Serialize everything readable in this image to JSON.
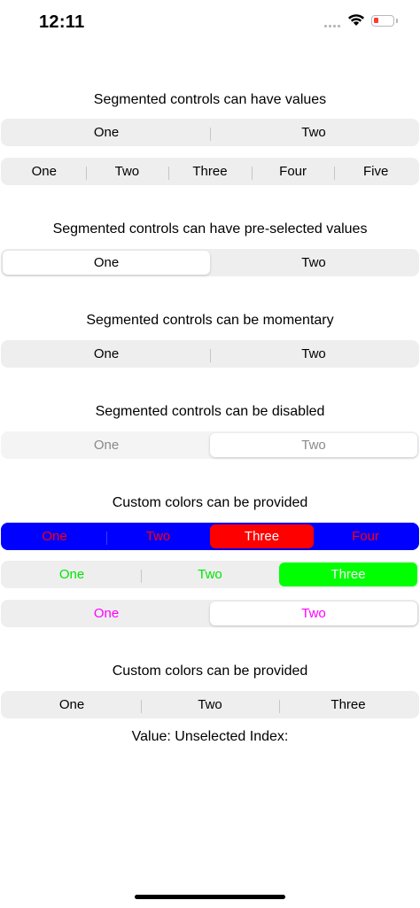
{
  "status": {
    "time": "12:11"
  },
  "sections": {
    "values": {
      "heading": "Segmented controls can have values",
      "two": [
        "One",
        "Two"
      ],
      "five": [
        "One",
        "Two",
        "Three",
        "Four",
        "Five"
      ]
    },
    "preselected": {
      "heading": "Segmented controls can have pre-selected values",
      "segments": [
        "One",
        "Two"
      ],
      "selected": "One"
    },
    "momentary": {
      "heading": "Segmented controls can be momentary",
      "segments": [
        "One",
        "Two"
      ]
    },
    "disabled": {
      "heading": "Segmented controls can be disabled",
      "segments": [
        "One",
        "Two"
      ],
      "selected": "Two"
    },
    "custom_colors": {
      "heading": "Custom colors can be provided",
      "blue": {
        "segments": [
          "One",
          "Two",
          "Three",
          "Four"
        ],
        "selected": "Three",
        "background": "#0000ff",
        "tint": "#ff0000",
        "text": "#ff0000"
      },
      "green": {
        "segments": [
          "One",
          "Two",
          "Three"
        ],
        "selected": "Three",
        "tint": "#00ff00",
        "text": "#00e600"
      },
      "magenta": {
        "segments": [
          "One",
          "Two"
        ],
        "selected": "Two",
        "text": "#ff00ff"
      }
    },
    "custom_colors_2": {
      "heading": "Custom colors can be provided",
      "segments": [
        "One",
        "Two",
        "Three"
      ],
      "value_line": "Value: Unselected Index:"
    }
  }
}
